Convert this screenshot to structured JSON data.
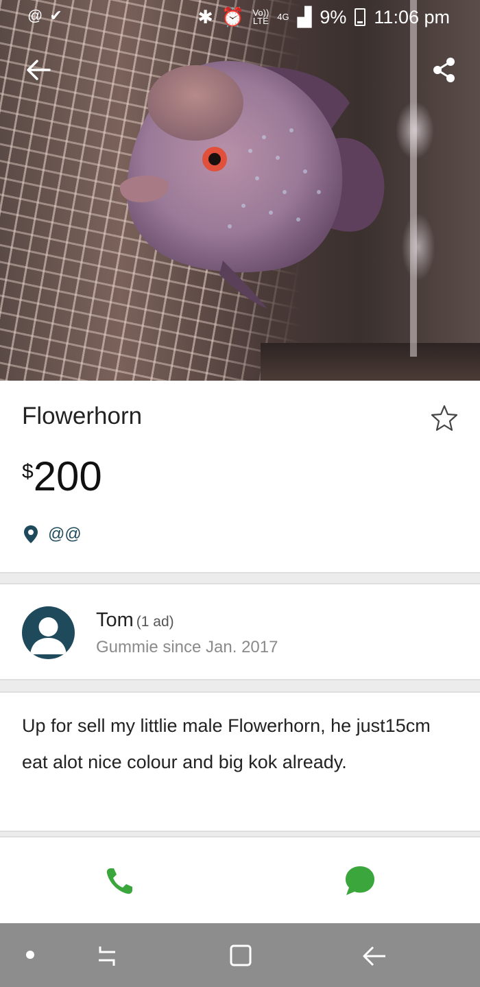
{
  "status_bar": {
    "volte": "Vo))",
    "lte": "LTE",
    "network": "4G",
    "battery": "9%",
    "time": "11:06 pm"
  },
  "listing": {
    "title": "Flowerhorn",
    "currency": "$",
    "price": "200",
    "location": "@@"
  },
  "seller": {
    "name": "Tom",
    "ad_count": "(1 ad)",
    "since": "Gummie since Jan. 2017"
  },
  "description": "Up for sell my littlie male Flowerhorn, he just15cm eat alot nice colour and big kok already.",
  "colors": {
    "brand": "#1f4a5c",
    "action_green": "#3aa63c",
    "nav_bar": "#8d8d8d"
  },
  "icons": {
    "back": "arrow-left-icon",
    "share": "share-icon",
    "favorite": "star-outline-icon",
    "location": "map-pin-icon",
    "call": "phone-icon",
    "chat": "chat-bubble-icon"
  }
}
